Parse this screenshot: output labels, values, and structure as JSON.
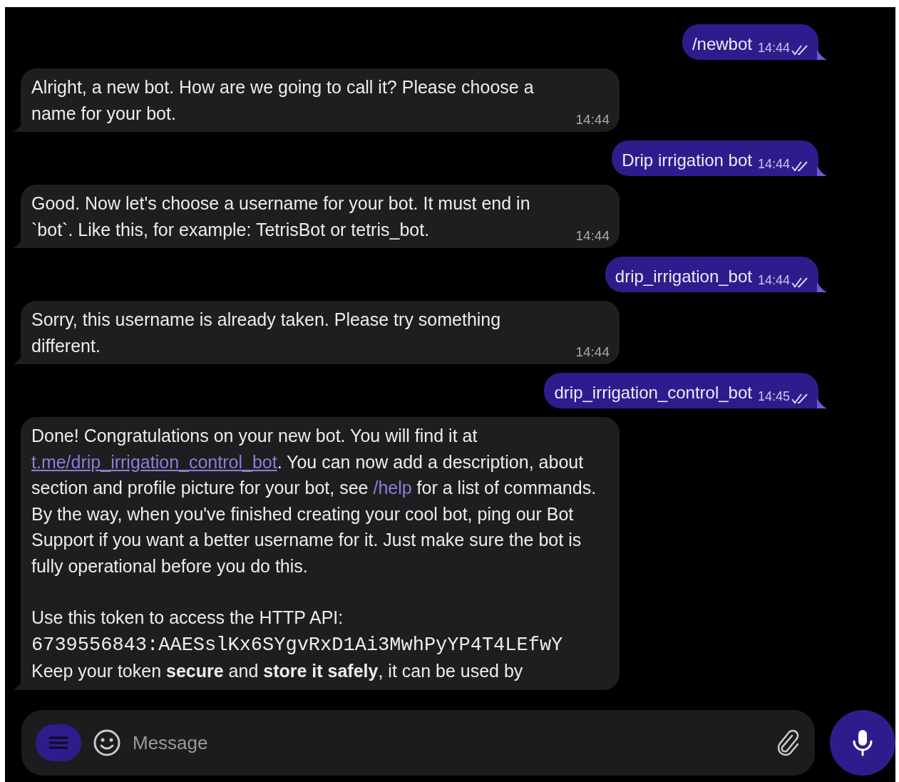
{
  "messages": [
    {
      "kind": "outgoing",
      "text": "/newbot",
      "time": "14:44",
      "read": true
    },
    {
      "kind": "incoming",
      "paragraphs": [
        [
          {
            "kind": "text",
            "text": "Alright, a new bot. How are we going to call it? Please choose a name for your bot."
          }
        ]
      ],
      "time": "14:44"
    },
    {
      "kind": "outgoing",
      "text": "Drip irrigation bot",
      "time": "14:44",
      "read": true
    },
    {
      "kind": "incoming",
      "paragraphs": [
        [
          {
            "kind": "text",
            "text": "Good. Now let's choose a username for your bot. It must end in `bot`. Like this, for example: TetrisBot or tetris_bot."
          }
        ]
      ],
      "time": "14:44"
    },
    {
      "kind": "outgoing",
      "text": "drip_irrigation_bot",
      "time": "14:44",
      "read": true
    },
    {
      "kind": "incoming",
      "paragraphs": [
        [
          {
            "kind": "text",
            "text": "Sorry, this username is already taken. Please try something different."
          }
        ]
      ],
      "time": "14:44"
    },
    {
      "kind": "outgoing",
      "text": "drip_irrigation_control_bot",
      "time": "14:45",
      "read": true
    },
    {
      "kind": "incoming",
      "paragraphs": [
        [
          {
            "kind": "text",
            "text": "Done! Congratulations on your new bot. You will find it at "
          },
          {
            "kind": "link",
            "text": "t.me/drip_irrigation_control_bot"
          },
          {
            "kind": "text",
            "text": ". You can now add a description, about section and profile picture for your bot, see "
          },
          {
            "kind": "command",
            "text": "/help"
          },
          {
            "kind": "text",
            "text": " for a list of commands. By the way, when you've finished creating your cool bot, ping our Bot Support if you want a better username for it. Just make sure the bot is fully operational before you do this."
          }
        ],
        [
          {
            "kind": "text",
            "text": "Use this token to access the HTTP API:"
          }
        ],
        [
          {
            "kind": "code",
            "text": "6739556843:AAESslKx6SYgvRxD1Ai3MwhPyYP4T4LEfwY"
          }
        ],
        [
          {
            "kind": "text",
            "text": "Keep your token **secure** and **store it safely**, it can be used by"
          }
        ]
      ]
    }
  ],
  "composer": {
    "placeholder": "Message"
  }
}
